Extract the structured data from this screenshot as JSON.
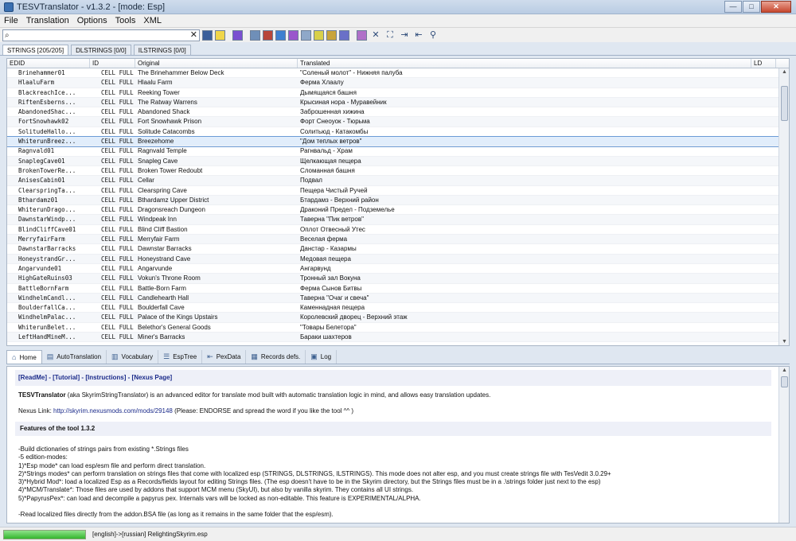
{
  "window": {
    "title": "TESVTranslator - v1.3.2 - [mode: Esp]",
    "min": "—",
    "max": "□",
    "close": "✕"
  },
  "menu": [
    "File",
    "Translation",
    "Options",
    "Tools",
    "XML"
  ],
  "search": {
    "value": "",
    "placeholder": "",
    "search_icon": "⌕",
    "clear_icon": "✕"
  },
  "toolbar_colors": [
    "#3b5f9a",
    "#f0d64a",
    "#7a4fd0",
    "#6f8fb8",
    "#b8463a",
    "#3e7fd0",
    "#9a55cc",
    "#8fa8c9",
    "#d8d04a",
    "#c8a43a",
    "#6a70c8",
    "#b070c8"
  ],
  "toolbar_glyphs": [
    "✕",
    "⛶",
    "⇥",
    "⇤",
    "⚲"
  ],
  "top_tabs": [
    "STRINGS [205/205]",
    "DLSTRINGS [0/0]",
    "ILSTRINGS [0/0]"
  ],
  "grid": {
    "headers": [
      "EDID",
      "ID",
      "Original",
      "Translated",
      "LD"
    ],
    "selected_index": 7,
    "rows": [
      {
        "edid": "Brinehammer01",
        "id": "CELL FULL",
        "original": "The Brinehammer Below Deck",
        "translated": "\"Соленый молот\" - Нижняя палуба"
      },
      {
        "edid": "HlaaluFarm",
        "id": "CELL FULL",
        "original": "Hlaalu Farm",
        "translated": "Ферма Хлаалу"
      },
      {
        "edid": "BlackreachIce...",
        "id": "CELL FULL",
        "original": "Reeking Tower",
        "translated": "Дымящаяся башня"
      },
      {
        "edid": "RiftenEsberns...",
        "id": "CELL FULL",
        "original": "The Ratway Warrens",
        "translated": "Крысиная нора - Муравейник"
      },
      {
        "edid": "AbandonedShac...",
        "id": "CELL FULL",
        "original": "Abandoned Shack",
        "translated": "Заброшенная хижина"
      },
      {
        "edid": "FortSnowhawk02",
        "id": "CELL FULL",
        "original": "Fort Snowhawk Prison",
        "translated": "Форт Снеоуок - Тюрьма"
      },
      {
        "edid": "SolitudeHallo...",
        "id": "CELL FULL",
        "original": "Solitude Catacombs",
        "translated": "Солитьюд - Катакомбы"
      },
      {
        "edid": "WhiterunBreez...",
        "id": "CELL FULL",
        "original": "Breezehome",
        "translated": "\"Дом теплых ветров\""
      },
      {
        "edid": "Ragnvald01",
        "id": "CELL FULL",
        "original": "Ragnvald Temple",
        "translated": "Рагнвальд - Храм"
      },
      {
        "edid": "SnaplegCave01",
        "id": "CELL FULL",
        "original": "Snapleg Cave",
        "translated": "Щелкающая пещера"
      },
      {
        "edid": "BrokenTowerRe...",
        "id": "CELL FULL",
        "original": "Broken Tower Redoubt",
        "translated": "Сломанная башня"
      },
      {
        "edid": "AnisesCabin01",
        "id": "CELL FULL",
        "original": "Cellar",
        "translated": "Подвал"
      },
      {
        "edid": "ClearspringTa...",
        "id": "CELL FULL",
        "original": "Clearspring Cave",
        "translated": "Пещера Чистый Ручей"
      },
      {
        "edid": "Bthardamz01",
        "id": "CELL FULL",
        "original": "Bthardamz Upper District",
        "translated": "Бтардамз - Верхний район"
      },
      {
        "edid": "WhiterunDrago...",
        "id": "CELL FULL",
        "original": "Dragonsreach Dungeon",
        "translated": "Драконий Предел - Подземелье"
      },
      {
        "edid": "DawnstarWindp...",
        "id": "CELL FULL",
        "original": "Windpeak Inn",
        "translated": "Таверна \"Пик ветров\""
      },
      {
        "edid": "BlindCliffCave01",
        "id": "CELL FULL",
        "original": "Blind Cliff Bastion",
        "translated": "Оплот Отвесный Утес"
      },
      {
        "edid": "MerryfairFarm",
        "id": "CELL FULL",
        "original": "Merryfair Farm",
        "translated": "Веселая ферма"
      },
      {
        "edid": "DawnstarBarracks",
        "id": "CELL FULL",
        "original": "Dawnstar Barracks",
        "translated": "Данстар - Казармы"
      },
      {
        "edid": "HoneystrandGr...",
        "id": "CELL FULL",
        "original": "Honeystrand Cave",
        "translated": "Медовая пещера"
      },
      {
        "edid": "Angarvunde01",
        "id": "CELL FULL",
        "original": "Angarvunde",
        "translated": "Ангарвунд"
      },
      {
        "edid": "HighGateRuins03",
        "id": "CELL FULL",
        "original": "Vokun's Throne Room",
        "translated": "Тронный зал Вокуна"
      },
      {
        "edid": "BattleBornFarm",
        "id": "CELL FULL",
        "original": "Battle-Born Farm",
        "translated": "Ферма Сынов Битвы"
      },
      {
        "edid": "WindhelmCandl...",
        "id": "CELL FULL",
        "original": "Candlehearth Hall",
        "translated": "Таверна \"Очаг и свеча\""
      },
      {
        "edid": "BoulderfallCa...",
        "id": "CELL FULL",
        "original": "Boulderfall Cave",
        "translated": "Каменнадная пещера"
      },
      {
        "edid": "WindhelmPalac...",
        "id": "CELL FULL",
        "original": "Palace of the Kings Upstairs",
        "translated": "Королевский дворец - Верхний этаж"
      },
      {
        "edid": "WhiterunBelet...",
        "id": "CELL FULL",
        "original": "Belethor's General Goods",
        "translated": "\"Товары Белетора\""
      },
      {
        "edid": "LeftHandMineM...",
        "id": "CELL FULL",
        "original": "Miner's Barracks",
        "translated": "Бараки шахтеров"
      }
    ]
  },
  "bottom_tabs": [
    {
      "label": "Home",
      "icon": "⌂"
    },
    {
      "label": "AutoTranslation",
      "icon": "▤"
    },
    {
      "label": "Vocabulary",
      "icon": "▥"
    },
    {
      "label": "EspTree",
      "icon": "☰"
    },
    {
      "label": "PexData",
      "icon": "⇤"
    },
    {
      "label": "Records defs.",
      "icon": "▦"
    },
    {
      "label": "Log",
      "icon": "▣"
    }
  ],
  "info": {
    "links": [
      "[ReadMe]",
      "[Tutorial]",
      "[Instructions]",
      "[Nexus Page]"
    ],
    "link_sep": " - ",
    "intro_bold": "TESVTranslator",
    "intro_rest": " (aka SkyrimStringTranslator) is an advanced editor for translate mod built with automatic translation logic in mind, and allows easy translation updates.",
    "nexus_label": "Nexus Link: ",
    "nexus_url": "http://skyrim.nexusmods.com/mods/29148",
    "nexus_rest": " (Please: ENDORSE and spread the word if you like the tool ^^ )",
    "features_heading": "Features of the tool 1.3.2",
    "features": [
      "-Build dictionaries of strings pairs from existing *.Strings files",
      "-5 edition-modes:",
      "1)*Esp mode*  can load esp/esm file and perform direct translation.",
      "2)*Strings modes*  can perform translation on strings files that come with localized esp (STRINGS, DLSTRINGS, ILSTRINGS). This mode does not alter esp, and you must create strings file with TesVedit 3.0.29+",
      "3)*Hybrid Mod*: load a localized Esp as a Records/fields layout for editing Strings files. (The esp doesn't have to be in the Skyrim directory, but the Strings files must be in a .\\strings folder just next to the esp)",
      "4)*MCM/Translate*: Those files are used by addons that support MCM menu (SkyUI), but also by vanilla skyrim. They contains all UI strings.",
      "5)*PapyrusPex*: can load and decompile a papyrus pex. Internals vars will be locked as non-editable. This feature is EXPERIMENTAL/ALPHA.",
      "",
      "-Read localized files directly from the addon.BSA file (as long as it remains in the same folder that the esp/esm)."
    ]
  },
  "status": {
    "progress": 1.0,
    "text": "[english]->[russian] RelightingSkyrim.esp"
  }
}
